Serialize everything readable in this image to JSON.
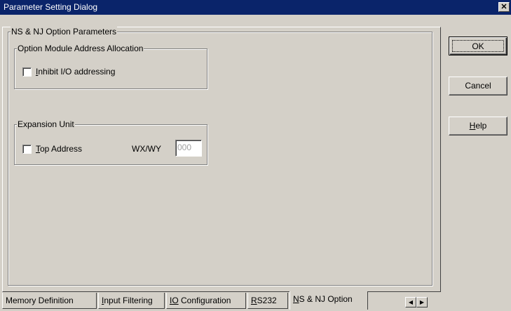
{
  "window": {
    "title": "Parameter Setting Dialog",
    "close_glyph": "✕"
  },
  "panel": {
    "title": "NS & NJ Option Parameters",
    "option_module": {
      "legend": "Option Module Address Allocation",
      "inhibit_checkbox": {
        "mnemonic": "I",
        "rest": "nhibit I/O addressing",
        "checked": false
      }
    },
    "expansion_unit": {
      "legend": "Expansion Unit",
      "top_address_checkbox": {
        "mnemonic": "T",
        "rest": "op Address",
        "checked": false
      },
      "wx_wy_label": "WX/WY",
      "wx_wy_value": "000"
    }
  },
  "buttons": {
    "ok": "OK",
    "cancel": "Cancel",
    "help_mnemonic": "H",
    "help_rest": "elp"
  },
  "tabs": [
    {
      "mnemonic": "",
      "pre": "Memory Definition",
      "rest": ""
    },
    {
      "mnemonic": "I",
      "pre": "",
      "rest": "nput Filtering"
    },
    {
      "mnemonic": "IO",
      "pre": "",
      "rest": " Configuration"
    },
    {
      "mnemonic": "R",
      "pre": "",
      "rest": "S232"
    },
    {
      "mnemonic": "N",
      "pre": "",
      "rest": "S & NJ Option"
    }
  ],
  "tab_scroll": {
    "left": "◀",
    "right": "▶"
  }
}
